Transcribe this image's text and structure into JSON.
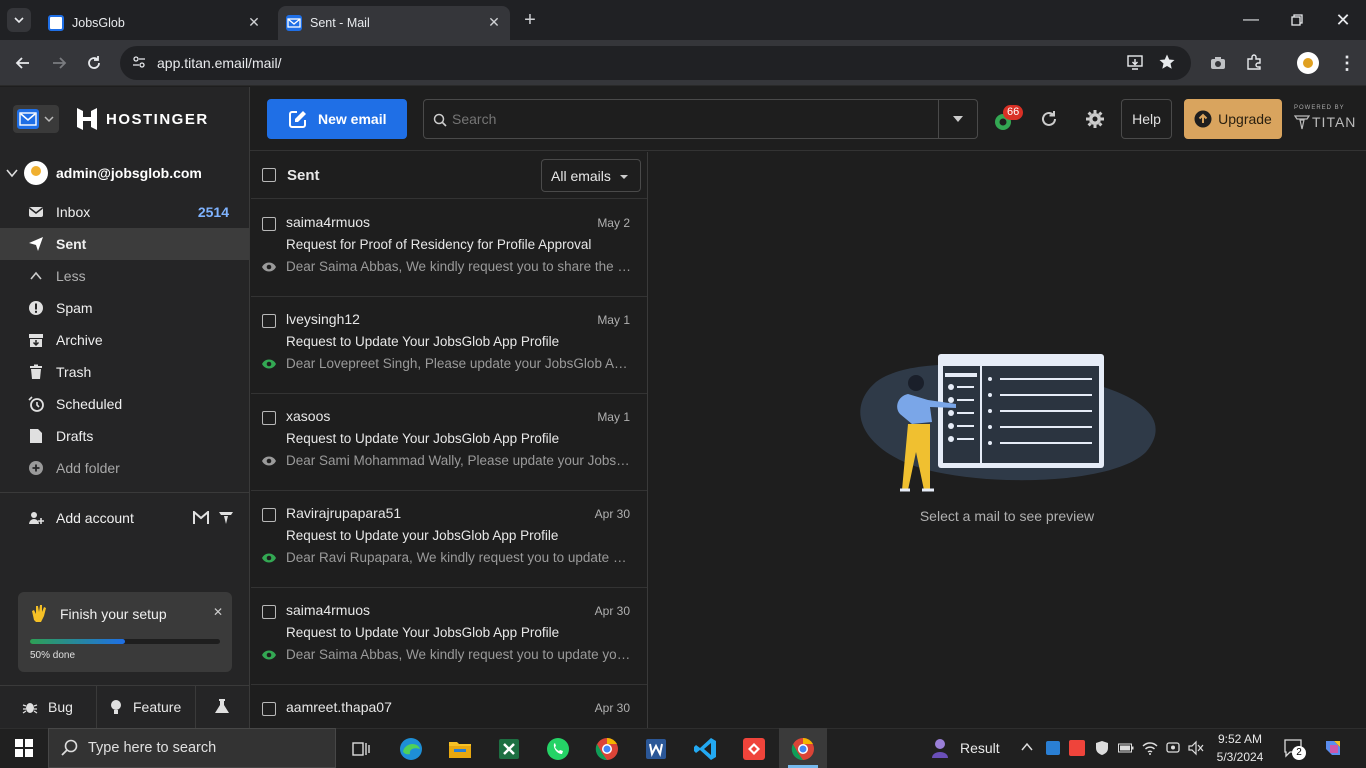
{
  "browser": {
    "tabs": [
      {
        "title": "JobsGlob",
        "active": false
      },
      {
        "title": "Sent - Mail",
        "active": true
      }
    ],
    "url": "app.titan.email/mail/"
  },
  "header": {
    "brand": "HOSTINGER",
    "new_email_label": "New email",
    "search_placeholder": "Search",
    "notification_count": "66",
    "help_label": "Help",
    "upgrade_label": "Upgrade",
    "powered_by": "POWERED BY",
    "powered_brand": "TITAN"
  },
  "sidebar": {
    "account": "admin@jobsglob.com",
    "items": [
      {
        "label": "Inbox",
        "count": "2514",
        "icon": "inbox-icon"
      },
      {
        "label": "Sent",
        "count": "",
        "icon": "sent-icon"
      },
      {
        "label": "Less",
        "count": "",
        "icon": "chevron-up-icon"
      },
      {
        "label": "Spam",
        "count": "",
        "icon": "spam-icon"
      },
      {
        "label": "Archive",
        "count": "",
        "icon": "archive-icon"
      },
      {
        "label": "Trash",
        "count": "",
        "icon": "trash-icon"
      },
      {
        "label": "Scheduled",
        "count": "",
        "icon": "scheduled-icon"
      },
      {
        "label": "Drafts",
        "count": "",
        "icon": "drafts-icon"
      },
      {
        "label": "Add folder",
        "count": "",
        "icon": "add-folder-icon"
      }
    ],
    "add_account_label": "Add account",
    "setup": {
      "title": "Finish your setup",
      "progress_label": "50% done",
      "progress_fraction": 0.5
    },
    "bottom": {
      "bug_label": "Bug",
      "feature_label": "Feature"
    }
  },
  "mail_list": {
    "folder_title": "Sent",
    "filter_label": "All emails",
    "messages": [
      {
        "sender": "saima4rmuos",
        "date": "May 2",
        "subject": "Request for Proof of Residency for Profile Approval",
        "preview": "Dear Saima Abbas, We kindly request you to share the document verifying your residency",
        "read": false
      },
      {
        "sender": "lveysingh12",
        "date": "May 1",
        "subject": "Request to Update Your JobsGlob App Profile",
        "preview": "Dear Lovepreet Singh, Please update your JobsGlob App profile as soon as possible",
        "read": true
      },
      {
        "sender": "xasoos",
        "date": "May 1",
        "subject": "Request to Update Your JobsGlob App Profile",
        "preview": "Dear Sami Mohammad Wally, Please update your JobsGlob App profile",
        "read": false
      },
      {
        "sender": "Ravirajrupapara51",
        "date": "Apr 30",
        "subject": "Request to Update your JobsGlob App Profile",
        "preview": "Dear Ravi Rupapara, We kindly request you to update your profile",
        "read": true
      },
      {
        "sender": "saima4rmuos",
        "date": "Apr 30",
        "subject": "Request to Update Your JobsGlob App Profile",
        "preview": "Dear Saima Abbas, We kindly request you to update your profile",
        "read": true
      },
      {
        "sender": "aamreet.thapa07",
        "date": "Apr 30",
        "subject": "",
        "preview": "",
        "read": false
      }
    ]
  },
  "preview_pane": {
    "empty_text": "Select a mail to see preview"
  },
  "taskbar": {
    "search_placeholder": "Type here to search",
    "result_label": "Result",
    "time": "9:52 AM",
    "date": "5/3/2024",
    "notification_count": "2"
  },
  "colors": {
    "accent": "#1f6fe6",
    "upgrade": "#d9a45e",
    "unread_eye": "#33a853",
    "badge": "#d93025"
  }
}
